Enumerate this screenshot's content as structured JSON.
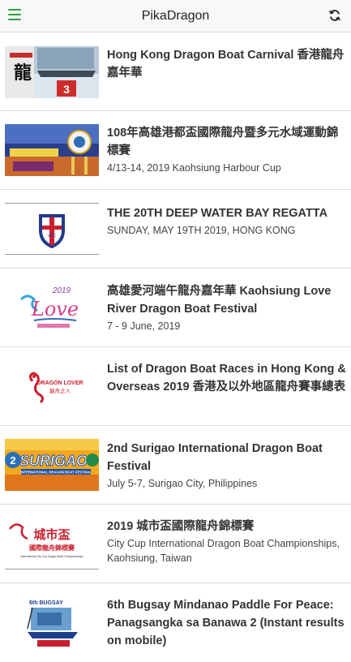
{
  "app": {
    "title": "PikaDragon",
    "menu_icon": "hamburger-menu-icon",
    "refresh_icon": "refresh-icon",
    "accent": "#2e9e3e"
  },
  "items": [
    {
      "title": "Hong Kong Dragon Boat Carnival 香港龍舟嘉年華",
      "subtitle": ""
    },
    {
      "title": "108年高雄港都盃國際龍舟暨多元水域運動錦標賽",
      "subtitle": "4/13-14, 2019 Kaohsiung Harbour Cup"
    },
    {
      "title": "THE 20TH DEEP WATER BAY REGATTA",
      "subtitle": "SUNDAY, MAY 19TH 2019, HONG KONG"
    },
    {
      "title": "高雄愛河端午龍舟嘉年華 Kaohsiung Love River Dragon Boat Festival",
      "subtitle": "7 - 9 June, 2019",
      "logo_text": "Love"
    },
    {
      "title": "List of Dragon Boat Races in Hong Kong & Overseas 2019 香港及以外地區龍舟賽事總表",
      "subtitle": "",
      "logo_text": "DRAGON LOVER",
      "logo_sub": "龍舟之人"
    },
    {
      "title": "2nd Surigao International Dragon Boat Festival",
      "subtitle": "July 5-7, Surigao City, Philippines",
      "logo_text": "SURIGAO",
      "logo_sub": "INTERNATIONAL DRAGON BOAT FESTIVAL"
    },
    {
      "title": "2019 城市盃國際龍舟錦標賽",
      "subtitle": "City Cup International Dragon Boat Championships, Kaohsiung, Taiwan",
      "logo_text": "城市盃",
      "logo_sub": "國際龍舟錦標賽",
      "logo_en": "International City Cup Dragon Boat Championships"
    },
    {
      "title": "6th Bugsay Mindanao Paddle For Peace: Panagsangka sa Banawa 2 (Instant results on mobile)",
      "subtitle": "",
      "logo_text": "6th BUGSAY"
    }
  ]
}
